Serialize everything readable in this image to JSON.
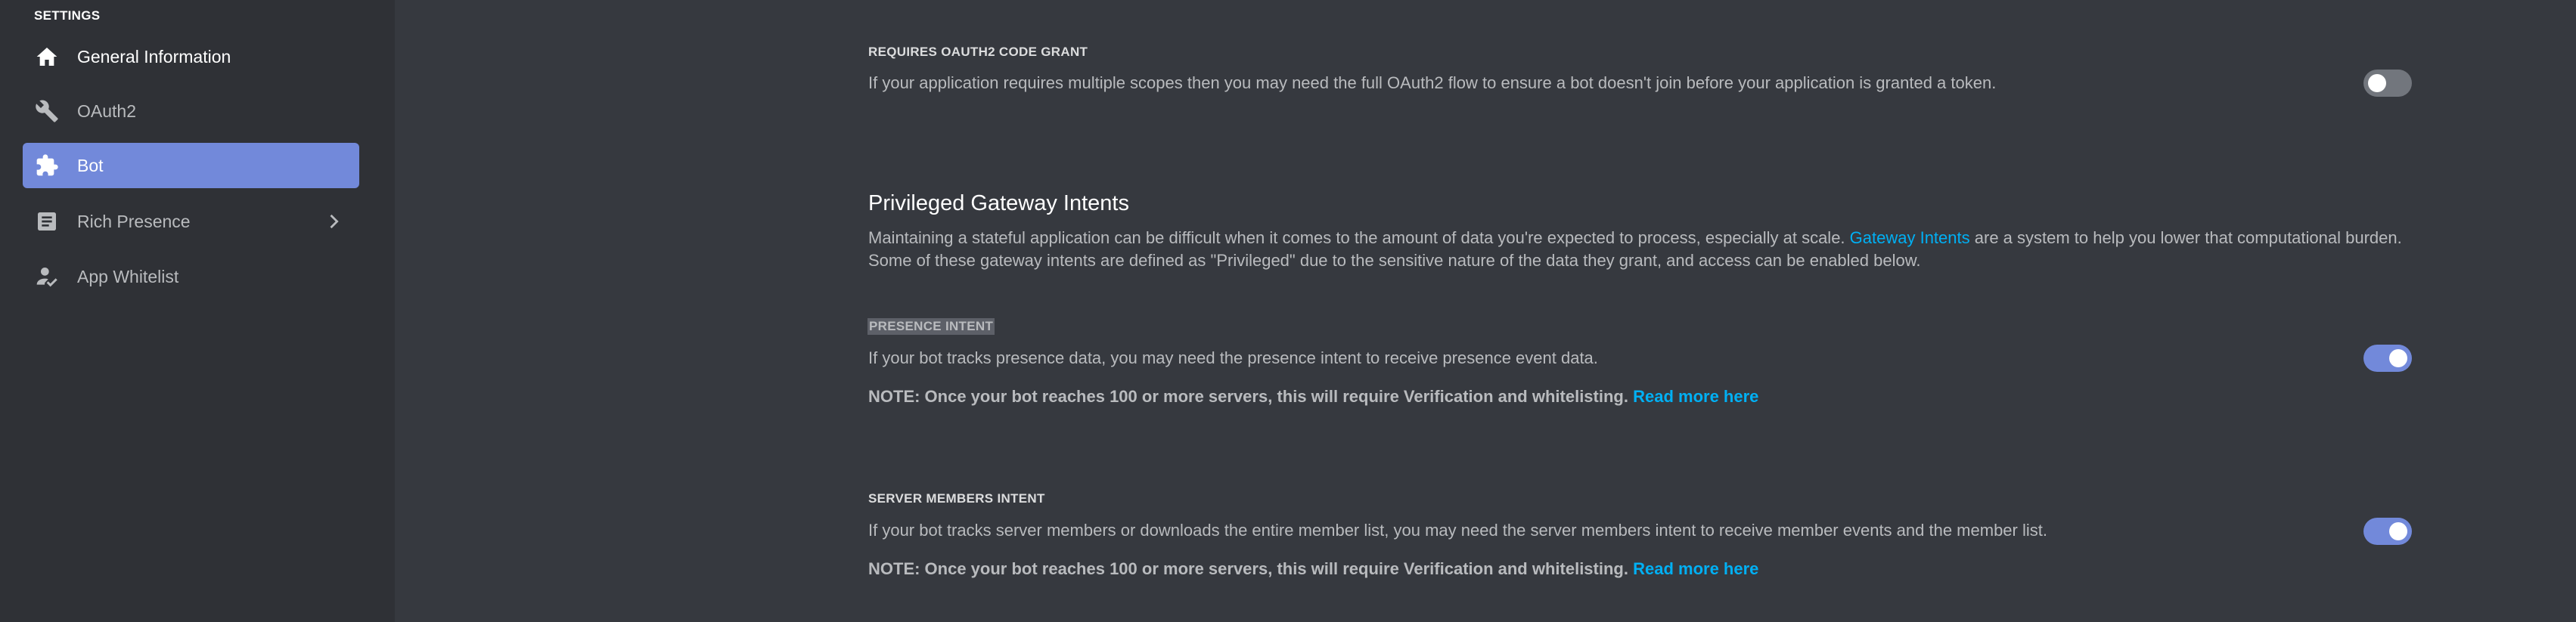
{
  "sidebar": {
    "header": "SETTINGS",
    "items": [
      {
        "label": "General Information",
        "icon": "home-icon"
      },
      {
        "label": "OAuth2",
        "icon": "wrench-icon"
      },
      {
        "label": "Bot",
        "icon": "puzzle-icon",
        "active": true
      },
      {
        "label": "Rich Presence",
        "icon": "document-icon",
        "has_submenu": true
      },
      {
        "label": "App Whitelist",
        "icon": "user-check-icon"
      }
    ]
  },
  "main": {
    "code_grant": {
      "label": "REQUIRES OAUTH2 CODE GRANT",
      "description": "If your application requires multiple scopes then you may need the full OAuth2 flow to ensure a bot doesn't join before your application is granted a token.",
      "enabled": false
    },
    "intents": {
      "heading": "Privileged Gateway Intents",
      "paragraph_pre": "Maintaining a stateful application can be difficult when it comes to the amount of data you're expected to process, especially at scale. ",
      "paragraph_link": "Gateway Intents",
      "paragraph_post": " are a system to help you lower that computational burden. Some of these gateway intents are defined as \"Privileged\" due to the sensitive nature of the data they grant, and access can be enabled below."
    },
    "presence_intent": {
      "label": "PRESENCE INTENT",
      "description": "If your bot tracks presence data, you may need the presence intent to receive presence event data.",
      "note": "NOTE: Once your bot reaches 100 or more servers, this will require Verification and whitelisting.",
      "link": "Read more here",
      "enabled": true
    },
    "server_members_intent": {
      "label": "SERVER MEMBERS INTENT",
      "description": "If your bot tracks server members or downloads the entire member list, you may need the server members intent to receive member events and the member list.",
      "note": "NOTE: Once your bot reaches 100 or more servers, this will require Verification and whitelisting.",
      "link": "Read more here",
      "enabled": true
    }
  },
  "colors": {
    "sidebar_bg": "#2f3136",
    "main_bg": "#36393f",
    "accent": "#7289da",
    "link": "#00b0f4",
    "toggle_off": "#72767d"
  }
}
